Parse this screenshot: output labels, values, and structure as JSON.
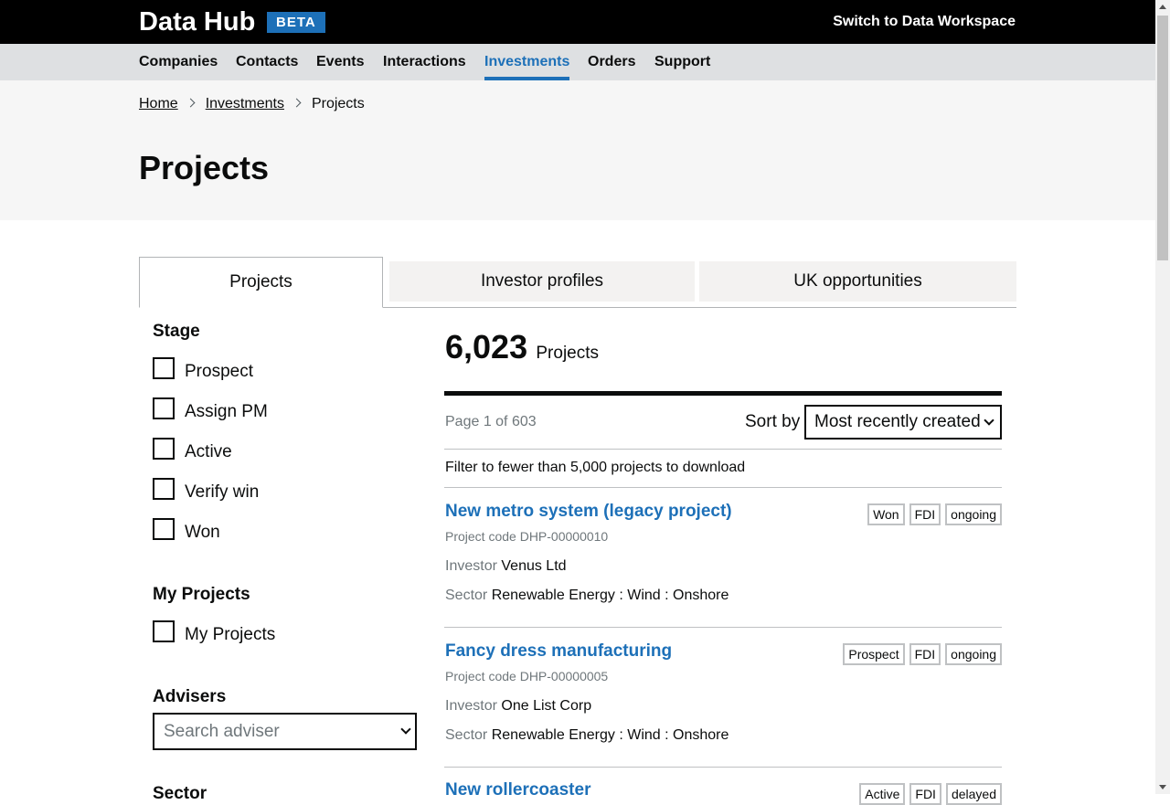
{
  "header": {
    "brand": "Data Hub",
    "beta": "BETA",
    "switch_link": "Switch to Data Workspace"
  },
  "nav": [
    {
      "label": "Companies"
    },
    {
      "label": "Contacts"
    },
    {
      "label": "Events"
    },
    {
      "label": "Interactions"
    },
    {
      "label": "Investments",
      "active": true
    },
    {
      "label": "Orders"
    },
    {
      "label": "Support"
    }
  ],
  "breadcrumbs": {
    "home": "Home",
    "investments": "Investments",
    "current": "Projects"
  },
  "page_title": "Projects",
  "tabs": [
    {
      "label": "Projects",
      "selected": true
    },
    {
      "label": "Investor profiles"
    },
    {
      "label": "UK opportunities"
    }
  ],
  "filters": {
    "stage": {
      "heading": "Stage",
      "options": [
        "Prospect",
        "Assign PM",
        "Active",
        "Verify win",
        "Won"
      ]
    },
    "my_projects": {
      "heading": "My Projects",
      "option": "My Projects"
    },
    "advisers": {
      "heading": "Advisers",
      "placeholder": "Search adviser"
    },
    "sector": {
      "heading": "Sector"
    }
  },
  "results": {
    "count": "6,023",
    "noun": "Projects",
    "page_info": "Page 1 of 603",
    "sort_label": "Sort by",
    "sort_value": "Most recently created",
    "download_note": "Filter to fewer than 5,000 projects to download",
    "investor_label": "Investor",
    "sector_label": "Sector",
    "items": [
      {
        "title": "New metro system (legacy project)",
        "code": "Project code DHP-00000010",
        "investor": "Venus Ltd",
        "sector": "Renewable Energy : Wind : Onshore",
        "badges": [
          "Won",
          "FDI",
          "ongoing"
        ]
      },
      {
        "title": "Fancy dress manufacturing",
        "code": "Project code DHP-00000005",
        "investor": "One List Corp",
        "sector": "Renewable Energy : Wind : Onshore",
        "badges": [
          "Prospect",
          "FDI",
          "ongoing"
        ]
      },
      {
        "title": "New rollercoaster",
        "badges": [
          "Active",
          "FDI",
          "delayed"
        ]
      }
    ]
  },
  "colors": {
    "link": "#1d70b8",
    "header_bg": "#000000",
    "nav_bg": "#dee0e2"
  }
}
